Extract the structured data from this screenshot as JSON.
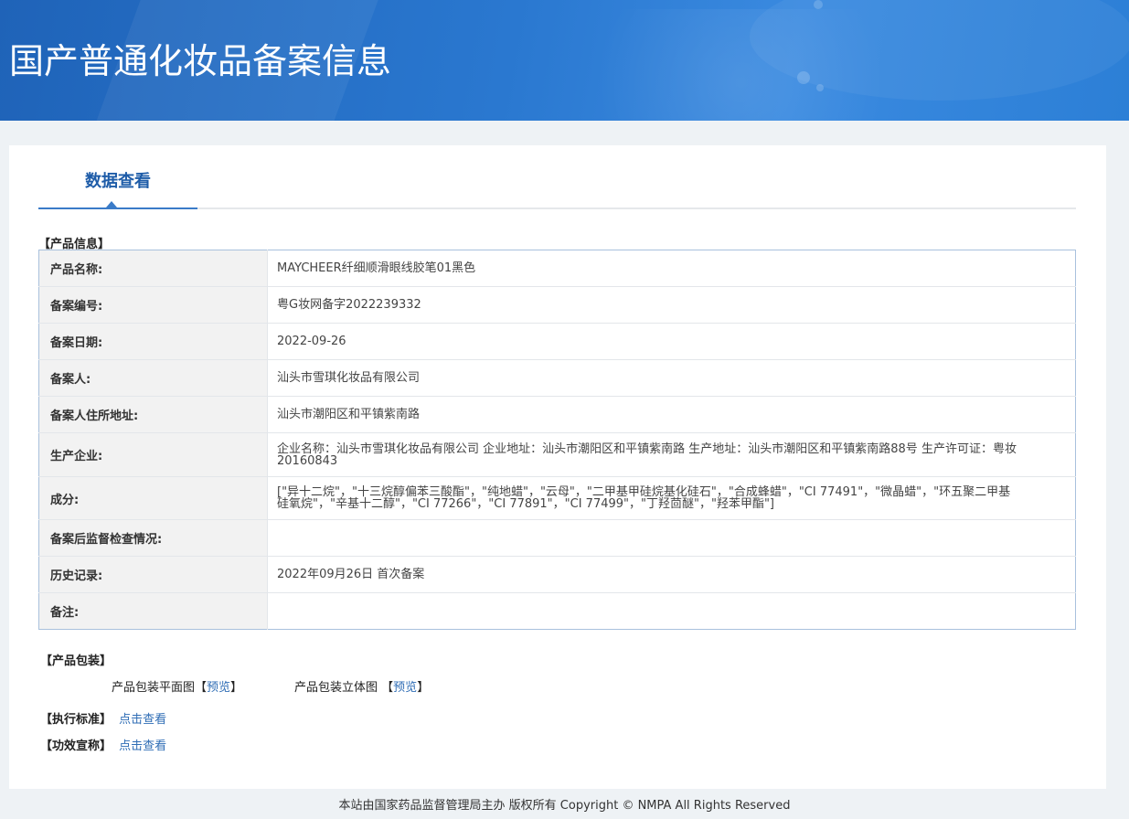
{
  "header": {
    "title": "国产普通化妆品备案信息"
  },
  "tab": {
    "label": "数据查看"
  },
  "product_info": {
    "section_title": "【产品信息】",
    "rows": [
      {
        "label": "产品名称:",
        "value": "MAYCHEER纤细顺滑眼线胶笔01黑色"
      },
      {
        "label": "备案编号:",
        "value": "粤G妆网备字2022239332"
      },
      {
        "label": "备案日期:",
        "value": "2022-09-26"
      },
      {
        "label": "备案人:",
        "value": "汕头市雪琪化妆品有限公司"
      },
      {
        "label": "备案人住所地址:",
        "value": "汕头市潮阳区和平镇紫南路"
      },
      {
        "label": "生产企业:",
        "value": "企业名称：汕头市雪琪化妆品有限公司 企业地址：汕头市潮阳区和平镇紫南路 生产地址：汕头市潮阳区和平镇紫南路88号 生产许可证：粤妆20160843"
      },
      {
        "label": "成分:",
        "value": "[\"异十二烷\"，\"十三烷醇偏苯三酸酯\"，\"纯地蜡\"，\"云母\"，\"二甲基甲硅烷基化硅石\"，\"合成蜂蜡\"，\"CI 77491\"，\"微晶蜡\"，\"环五聚二甲基硅氧烷\"，\"辛基十二醇\"，\"CI 77266\"，\"CI 77891\"，\"CI 77499\"，\"丁羟茴醚\"，\"羟苯甲酯\"]"
      },
      {
        "label": "备案后监督检查情况:",
        "value": ""
      },
      {
        "label": "历史记录:",
        "value": "2022年09月26日 首次备案"
      },
      {
        "label": "备注:",
        "value": ""
      }
    ]
  },
  "packaging": {
    "section_title": "【产品包装】",
    "flat_label": "产品包装平面图",
    "solid_label": "产品包装立体图",
    "preview_link": "预览",
    "bracket_open": "【",
    "bracket_close": "】"
  },
  "standard": {
    "label": "【执行标准】",
    "link": "点击查看"
  },
  "efficacy": {
    "label": "【功效宣称】",
    "link": "点击查看"
  },
  "footer": {
    "text": "本站由国家药品监督管理局主办 版权所有 Copyright © NMPA All Rights Reserved"
  },
  "colors": {
    "banner": "#2a78d0",
    "accent": "#1e5ca8",
    "link": "#2f6db5"
  }
}
